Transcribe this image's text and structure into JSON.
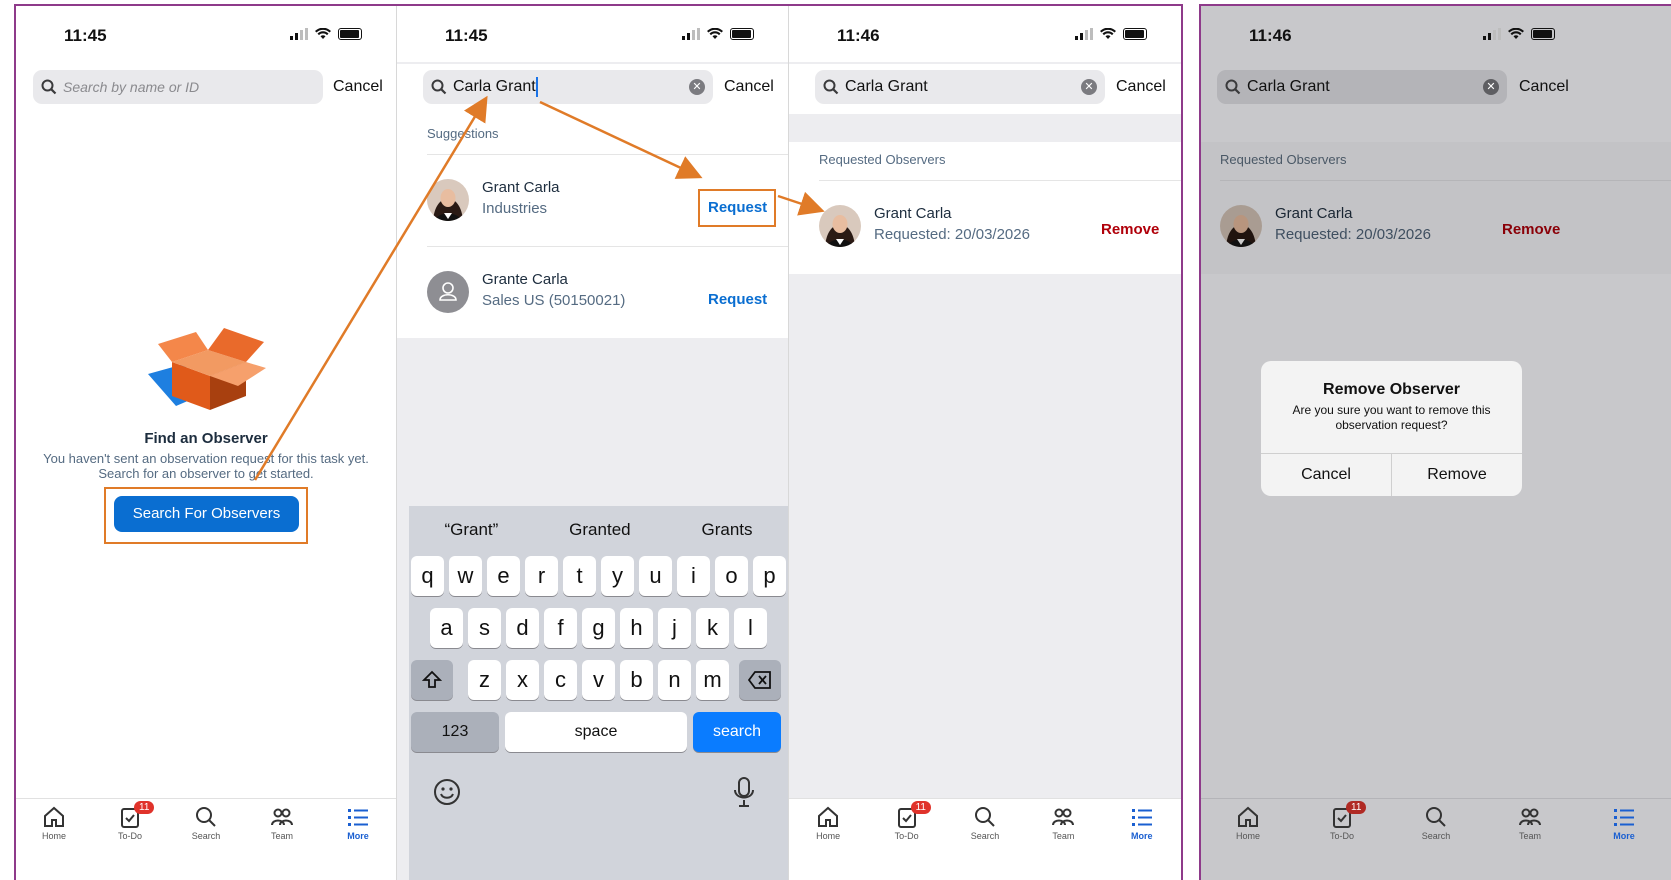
{
  "screens": [
    {
      "time": "11:45",
      "search": {
        "placeholder": "Search by name or ID",
        "cancel": "Cancel"
      },
      "empty": {
        "title": "Find an Observer",
        "line1": "You haven't sent an observation request for this task yet.",
        "line2": "Search for an observer to get started.",
        "button": "Search For Observers"
      }
    },
    {
      "time": "11:45",
      "search": {
        "value": "Carla Grant",
        "cancel": "Cancel"
      },
      "suggestions_header": "Suggestions",
      "suggestions": [
        {
          "name": "Grant Carla",
          "detail": "Industries",
          "action": "Request"
        },
        {
          "name": "Grante Carla",
          "detail": "Sales US (50150021)",
          "action": "Request"
        }
      ],
      "keyboard": {
        "predictions": [
          "“Grant”",
          "Granted",
          "Grants"
        ],
        "row1": [
          "q",
          "w",
          "e",
          "r",
          "t",
          "y",
          "u",
          "i",
          "o",
          "p"
        ],
        "row2": [
          "a",
          "s",
          "d",
          "f",
          "g",
          "h",
          "j",
          "k",
          "l"
        ],
        "row3": [
          "z",
          "x",
          "c",
          "v",
          "b",
          "n",
          "m"
        ],
        "numbers": "123",
        "space": "space",
        "search": "search"
      }
    },
    {
      "time": "11:46",
      "search": {
        "value": "Carla Grant",
        "cancel": "Cancel"
      },
      "section": "Requested Observers",
      "observer": {
        "name": "Grant Carla",
        "requested": "Requested: 20/03/2026",
        "action": "Remove"
      }
    },
    {
      "time": "11:46",
      "search": {
        "value": "Carla Grant",
        "cancel": "Cancel"
      },
      "section": "Requested Observers",
      "observer": {
        "name": "Grant Carla",
        "requested": "Requested: 20/03/2026",
        "action": "Remove"
      },
      "dialog": {
        "title": "Remove Observer",
        "message": "Are you sure you want to remove this observation request?",
        "cancel": "Cancel",
        "confirm": "Remove"
      }
    }
  ],
  "tabbar": {
    "items": [
      {
        "label": "Home",
        "icon": "home-icon"
      },
      {
        "label": "To-Do",
        "icon": "todo-icon",
        "badge": "11"
      },
      {
        "label": "Search",
        "icon": "search-icon"
      },
      {
        "label": "Team",
        "icon": "team-icon"
      },
      {
        "label": "More",
        "icon": "menu-icon",
        "active": true
      }
    ]
  },
  "colors": {
    "accent": "#0a6ed1",
    "danger": "#b0000a",
    "annotation": "#e07b28",
    "frame": "#8e3a8a",
    "badge": "#e0332b"
  }
}
